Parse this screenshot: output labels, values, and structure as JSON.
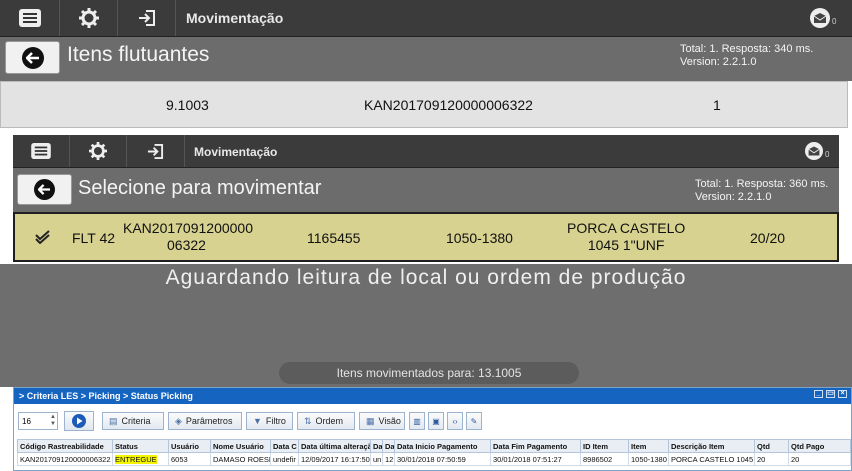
{
  "panel1": {
    "title": "Movimentação",
    "mail_count": "0",
    "heading": "Itens flutuantes",
    "info_total": "Total: 1. Resposta: 340 ms.",
    "info_version": "Version: 2.2.1.0",
    "row": [
      "9.1003",
      "KAN201709120000006322",
      "1"
    ]
  },
  "panel2": {
    "title": "Movimentação",
    "mail_count": "0",
    "heading": "Selecione para movimentar",
    "info_total": "Total: 1. Resposta: 360 ms.",
    "info_version": "Version: 2.2.1.0",
    "row": {
      "flt": "FLT 42",
      "kan_line1": "KAN2017091200000",
      "kan_line2": "06322",
      "code": "1165455",
      "range": "1050-1380",
      "desc_line1": "PORCA CASTELO",
      "desc_line2": "1045 1\"UNF",
      "qty": "20/20"
    }
  },
  "status": {
    "banner": "Aguardando leitura de local ou ordem de produção",
    "moved_to": "Itens movimentados para: 13.1005"
  },
  "window": {
    "breadcrumb": "> Criteria LES > Picking > Status Picking",
    "page_size": "16",
    "buttons": {
      "criteria": "Criteria",
      "parametros": "Parâmetros",
      "filtro": "Filtro",
      "ordem": "Ordem",
      "visao": "Visão"
    },
    "columns": [
      "Código Rastreabilidade",
      "Status",
      "Usuário",
      "Nome Usuário",
      "Data C",
      "Data última alteração",
      "Da",
      "Da",
      "Data Inicio Pagamento",
      "Data Fim Pagamento",
      "ID Item",
      "Item",
      "Descrição Item",
      "Qtd",
      "Qtd Pago"
    ],
    "row": [
      "KAN201709120000006322",
      "ENTREGUE",
      "6053",
      "DAMASO ROESE",
      "undefir",
      "12/09/2017 16:17:50",
      "un",
      "12,",
      "30/01/2018 07:50:59",
      "30/01/2018 07:51:27",
      "8986502",
      "1050-1380",
      "PORCA CASTELO 1045 1",
      "20",
      "20"
    ]
  }
}
